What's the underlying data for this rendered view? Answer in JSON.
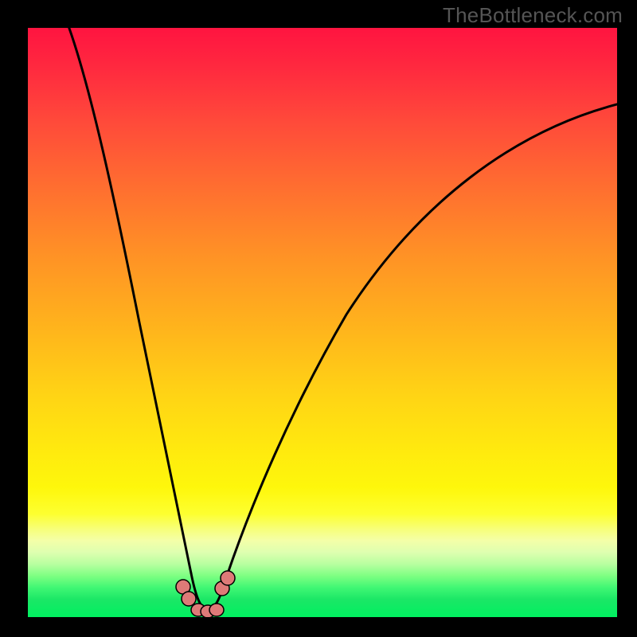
{
  "watermark": "TheBottleneck.com",
  "chart_data": {
    "type": "line",
    "title": "",
    "xlabel": "",
    "ylabel": "",
    "xlim": [
      0,
      100
    ],
    "ylim": [
      0,
      100
    ],
    "grid": false,
    "legend": false,
    "annotations": [],
    "series": [
      {
        "name": "curve-left",
        "x": [
          7,
          9,
          11,
          13,
          15,
          17,
          19,
          21,
          23,
          24.7,
          26.3,
          27.7
        ],
        "values": [
          100,
          85,
          71,
          58,
          46,
          36,
          27,
          19,
          12,
          7,
          3.5,
          1.5
        ]
      },
      {
        "name": "curve-right",
        "x": [
          33.8,
          36,
          39,
          43,
          48,
          54,
          61,
          69,
          78,
          88,
          100
        ],
        "values": [
          1.5,
          4,
          9,
          16,
          25,
          35,
          46,
          57,
          68,
          78,
          87
        ]
      },
      {
        "name": "minimum-segment",
        "x": [
          27.7,
          29,
          30.5,
          32,
          33.8
        ],
        "values": [
          1.5,
          0.7,
          0.5,
          0.7,
          1.5
        ]
      }
    ],
    "markers": [
      {
        "name": "marker-left-1",
        "x": 26.3,
        "y": 3.5
      },
      {
        "name": "marker-left-2",
        "x": 27.3,
        "y": 1.8
      },
      {
        "name": "marker-right-1",
        "x": 33.0,
        "y": 1.2
      },
      {
        "name": "marker-right-2",
        "x": 34.2,
        "y": 2.2
      },
      {
        "name": "marker-bottom-1",
        "x": 29.0,
        "y": 0.7
      },
      {
        "name": "marker-bottom-2",
        "x": 30.5,
        "y": 0.5
      },
      {
        "name": "marker-bottom-3",
        "x": 32.0,
        "y": 0.7
      }
    ],
    "colors": {
      "curve": "#000000",
      "marker_fill": "#de7a78",
      "marker_stroke": "#000000",
      "background_top": "#ff1440",
      "background_yellow": "#ffe80f",
      "background_bottom": "#00f060",
      "frame_border": "#000000"
    }
  }
}
